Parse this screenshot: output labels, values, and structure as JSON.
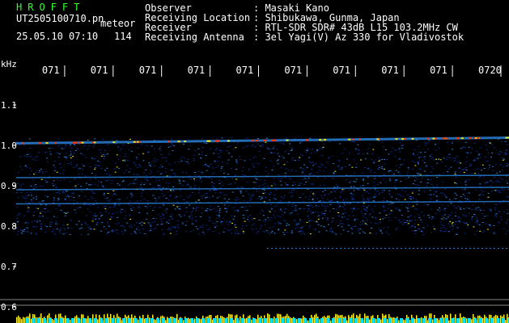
{
  "header": {
    "app_name": "HROFFT",
    "file_name": "UT2505100710.pn",
    "meteor_label": "meteor",
    "datetime": "25.05.10 07:10",
    "count": "114",
    "info_labels": [
      "Observer",
      "Receiving Location",
      "Receiver",
      "Receiving Antenna"
    ],
    "info_values": [
      ": Masaki Kano",
      ": Shibukawa, Gunma, Japan",
      ": RTL-SDR SDR# 43dB L15 103.2MHz CW",
      ": 3el Yagi(V) Az 330 for Vladivostok"
    ]
  },
  "colors": {
    "background": "#000000",
    "app_name": "#33ff33",
    "text": "#ffffff",
    "noise_low": "#0a2a8a",
    "noise_mid": "#2a7fd6",
    "noise_high": "#e6e61a",
    "hot": "#ff3300",
    "level_bar": "#ffee22",
    "level_base": "#00e0ff"
  },
  "chart_data": {
    "type": "heatmap",
    "ylabel": "kHz",
    "y_ticks": [
      "1.1",
      "1.0",
      "0.9",
      "0.8",
      "0.7",
      "0.6"
    ],
    "y_tick_values": [
      1.1,
      1.0,
      0.9,
      0.8,
      0.7,
      0.6
    ],
    "ylim": [
      0.59,
      1.19
    ],
    "x_ticks": [
      "071",
      "071",
      "071",
      "071",
      "071",
      "071",
      "071",
      "071",
      "071",
      "0720"
    ],
    "x_tick_minutes": [
      11,
      12,
      13,
      14,
      15,
      16,
      17,
      18,
      19,
      20
    ],
    "xlim_minutes": [
      10,
      20
    ],
    "signal_lines_khz": [
      1.005,
      0.92,
      0.89,
      0.855
    ],
    "noise_band_khz": [
      0.78,
      1.02
    ],
    "faint_line_khz": 0.745
  }
}
